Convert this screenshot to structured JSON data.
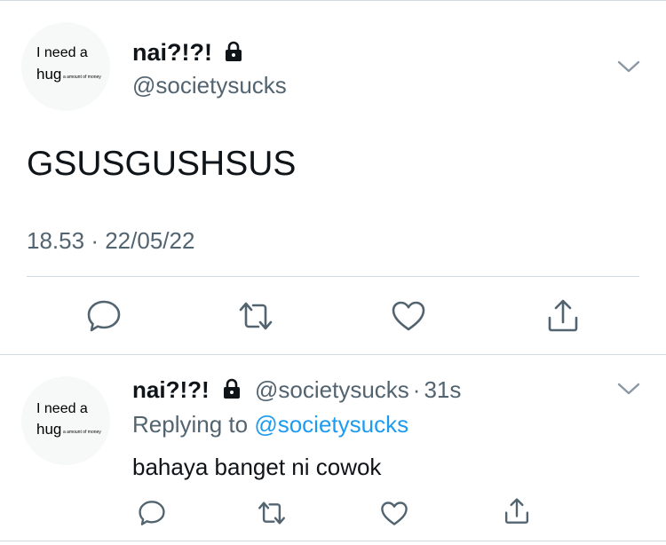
{
  "main_tweet": {
    "avatar": {
      "line1": "I need a",
      "line2": "hug",
      "tiny": "a amount of money"
    },
    "display_name": "nai?!?!",
    "handle": "@societysucks",
    "text": "GSUSGUSHSUS",
    "time": "18.53",
    "separator": "·",
    "date": "22/05/22"
  },
  "reply_tweet": {
    "avatar": {
      "line1": "I need a",
      "line2": "hug",
      "tiny": "a amount of money"
    },
    "display_name": "nai?!?!",
    "handle": "@societysucks",
    "separator": "·",
    "age": "31s",
    "replying_label": "Replying to",
    "replying_handle": "@societysucks",
    "text": "bahaya banget ni cowok"
  },
  "icons": {
    "lock": "lock-icon",
    "menu": "chevron-down-icon",
    "reply": "comment-icon",
    "retweet": "retweet-icon",
    "like": "heart-icon",
    "share": "share-icon"
  },
  "colors": {
    "text": "#0f1419",
    "secondary": "#536471",
    "link": "#1d9bf0",
    "divider": "#cfd9de"
  }
}
